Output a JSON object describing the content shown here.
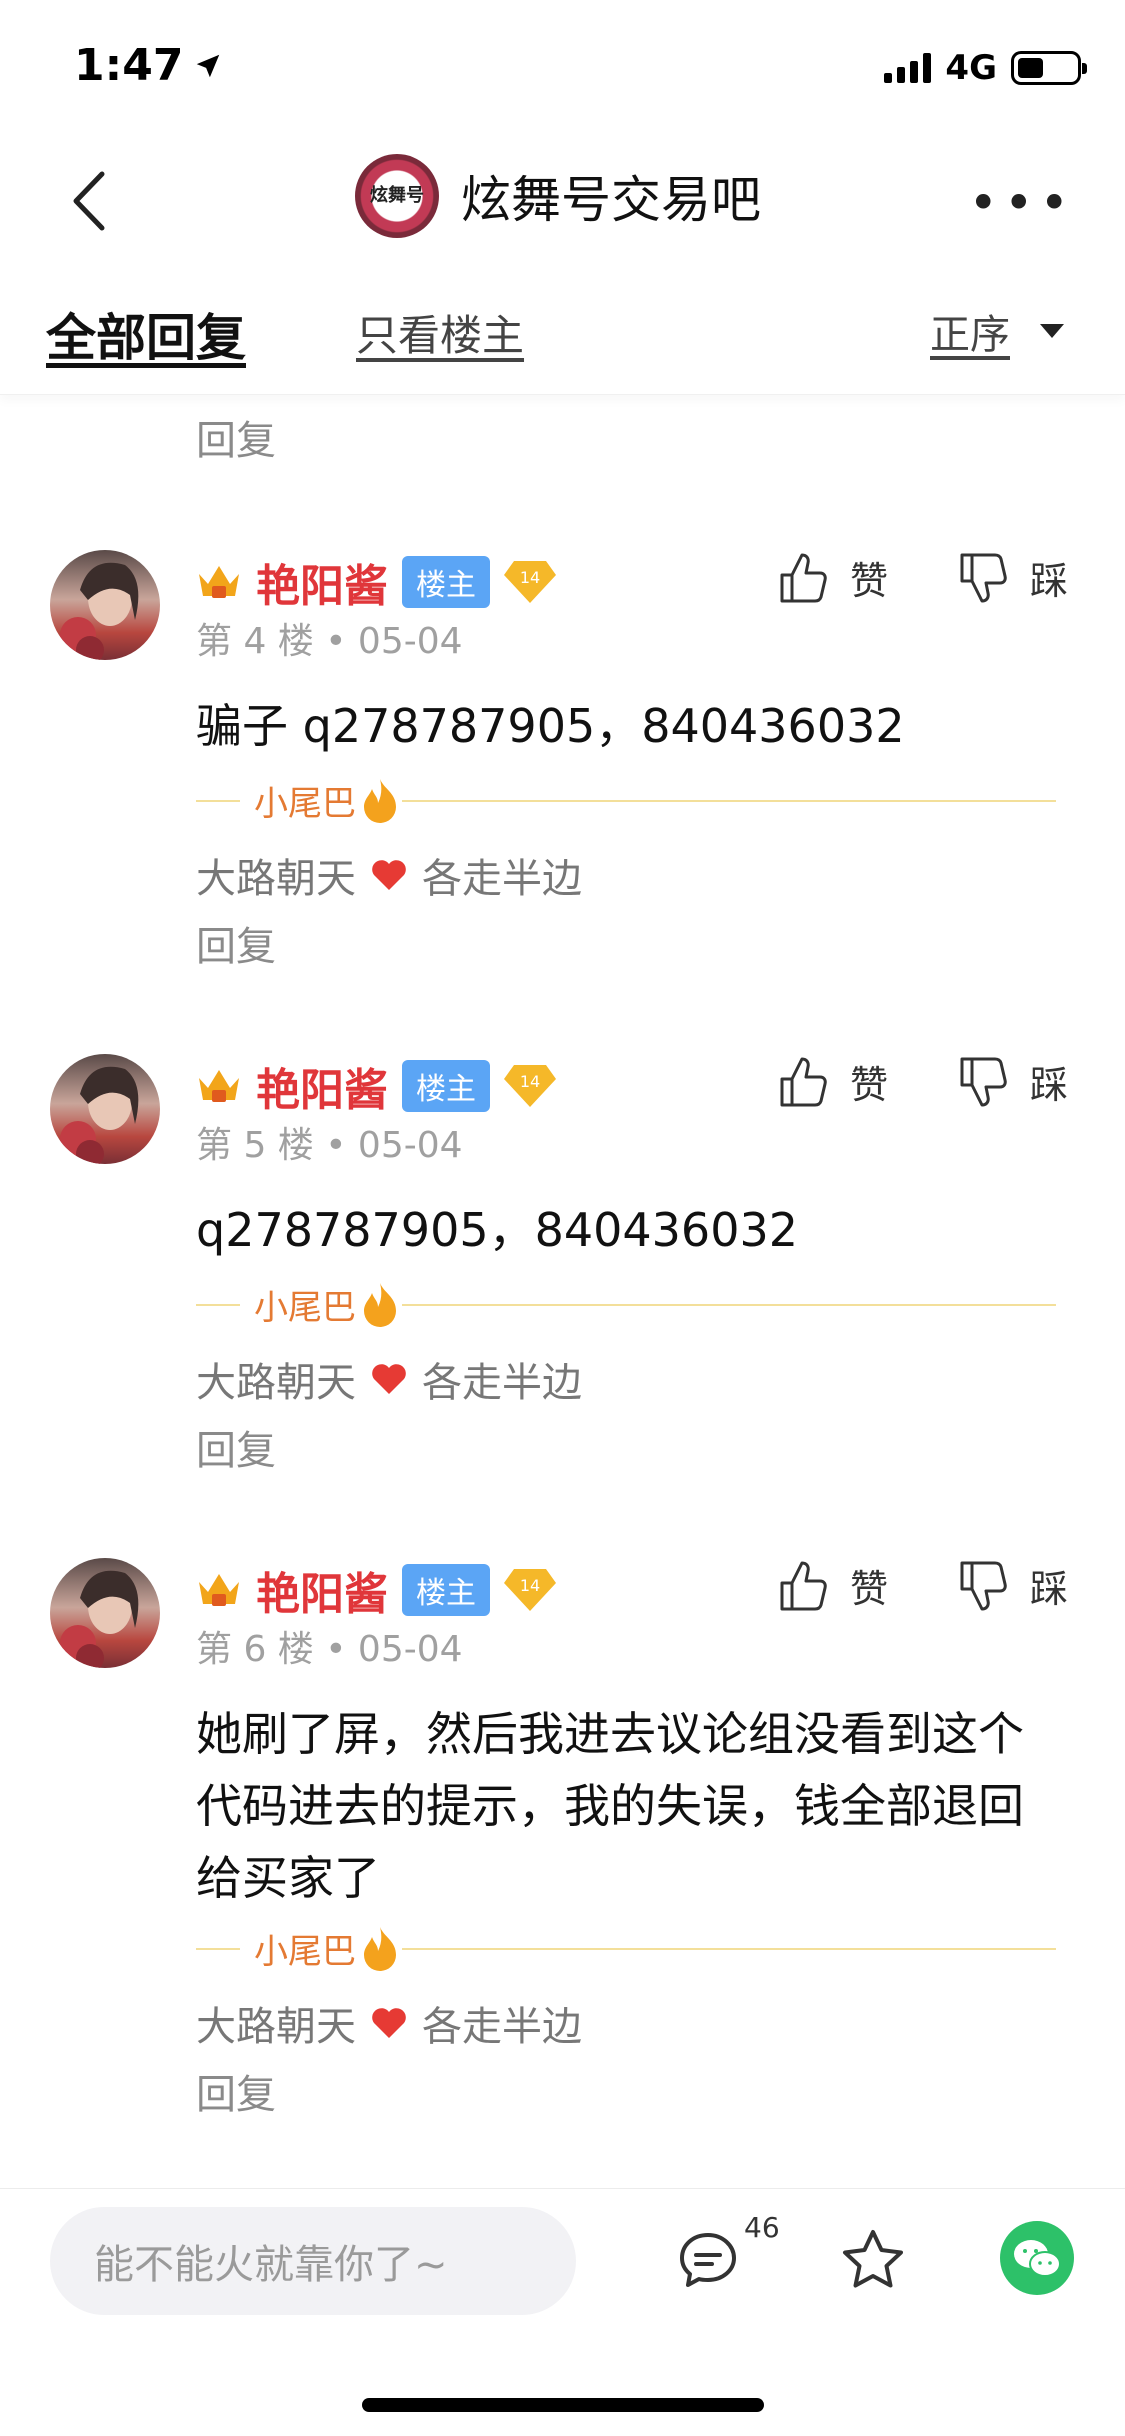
{
  "status": {
    "time": "1:47",
    "network": "4G"
  },
  "nav": {
    "forum_title": "炫舞号交易吧",
    "logo_text": "炫舞号"
  },
  "tabs": {
    "all": "全部回复",
    "op_only": "只看楼主",
    "sort": "正序"
  },
  "top_reply": "回复",
  "posts": [
    {
      "username": "艳阳酱",
      "badge": "楼主",
      "level": "14",
      "meta": "第 4 楼 • 05-04",
      "content": "骗子 q278787905，840436032",
      "tail_label": "小尾巴",
      "sign_left": "大路朝天",
      "sign_right": "各走半边",
      "reply": "回复",
      "like": "赞",
      "dislike": "踩"
    },
    {
      "username": "艳阳酱",
      "badge": "楼主",
      "level": "14",
      "meta": "第 5 楼 • 05-04",
      "content": "q278787905，840436032",
      "tail_label": "小尾巴",
      "sign_left": "大路朝天",
      "sign_right": "各走半边",
      "reply": "回复",
      "like": "赞",
      "dislike": "踩"
    },
    {
      "username": "艳阳酱",
      "badge": "楼主",
      "level": "14",
      "meta": "第 6 楼 • 05-04",
      "content": "她刷了屏，然后我进去议论组没看到这个代码进去的提示，我的失误，钱全部退回给买家了",
      "tail_label": "小尾巴",
      "sign_left": "大路朝天",
      "sign_right": "各走半边",
      "reply": "回复",
      "like": "赞",
      "dislike": "踩"
    }
  ],
  "bottom": {
    "input_placeholder": "能不能火就靠你了~",
    "comment_count": "46"
  },
  "colors": {
    "username": "#e0363a",
    "badge": "#5ba5f5",
    "wechat": "#2dc169",
    "tail_line": "#f3df9a"
  }
}
